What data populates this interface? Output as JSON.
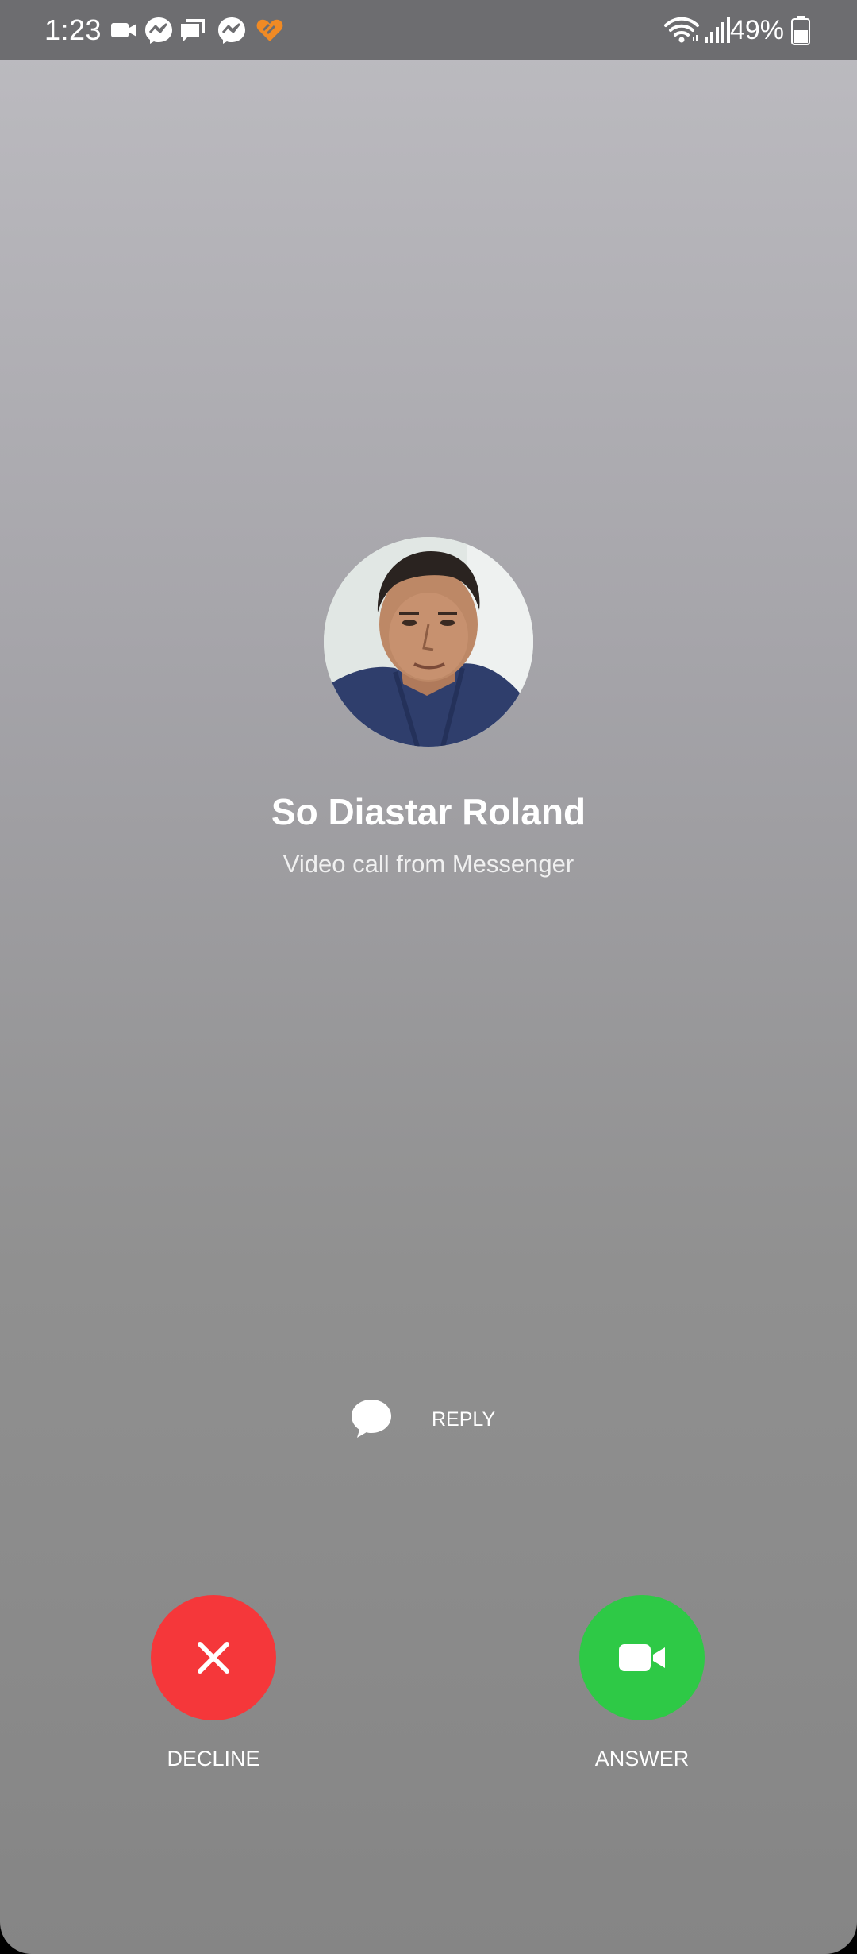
{
  "status_bar": {
    "time": "1:23",
    "battery_percent": "49%",
    "notification_icons": [
      "video-camera-icon",
      "messenger-icon",
      "chat-bubbles-icon",
      "messenger-icon",
      "app-heart-icon"
    ],
    "system_icons": [
      "wifi-icon",
      "signal-icon",
      "battery-icon"
    ]
  },
  "call": {
    "caller_name": "So Diastar Roland",
    "subtitle": "Video call from Messenger",
    "avatar_icon": "caller-avatar"
  },
  "actions": {
    "reply_label": "REPLY",
    "decline_label": "DECLINE",
    "answer_label": "ANSWER"
  },
  "colors": {
    "decline": "#f5373a",
    "answer": "#2ec946",
    "status_bar": "#6d6d70"
  }
}
